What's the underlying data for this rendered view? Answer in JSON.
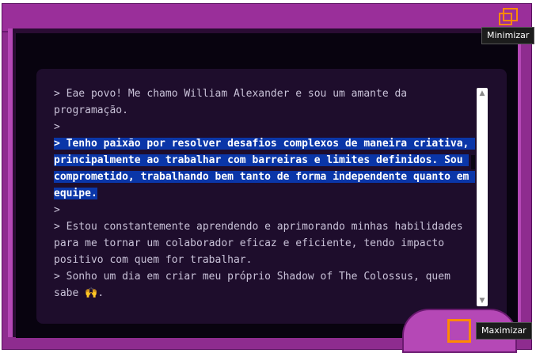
{
  "window": {
    "accent_color": "#8e2c8f",
    "frame_color": "#b548b6"
  },
  "terminal": {
    "lines": [
      {
        "text": "> Eae povo! Me chamo William Alexander e sou um amante da programação.",
        "selected": false
      },
      {
        "text": ">",
        "selected": false
      },
      {
        "text": "> Tenho paixão por resolver desafios complexos de maneira criativa, principalmente ao trabalhar com barreiras e limites definidos. Sou comprometido, trabalhando bem tanto de forma independente quanto em equipe.",
        "selected": true
      },
      {
        "text": ">",
        "selected": false
      },
      {
        "text": "> Estou constantemente aprendendo e aprimorando minhas habilidades para me tornar um colaborador eficaz e eficiente, tendo impacto positivo com quem for trabalhar.",
        "selected": false
      },
      {
        "text": "> Sonho um dia em criar meu próprio Shadow of The Colossus, quem sabe 🙌.",
        "selected": false
      }
    ],
    "selection_color": "#0a36a8"
  },
  "controls": {
    "minimize_tooltip": "Minimizar",
    "maximize_tooltip": "Maximizar",
    "minimize_icon": "restore-squares-icon",
    "maximize_icon": "square-outline-icon",
    "icon_color": "#ff8a00"
  }
}
